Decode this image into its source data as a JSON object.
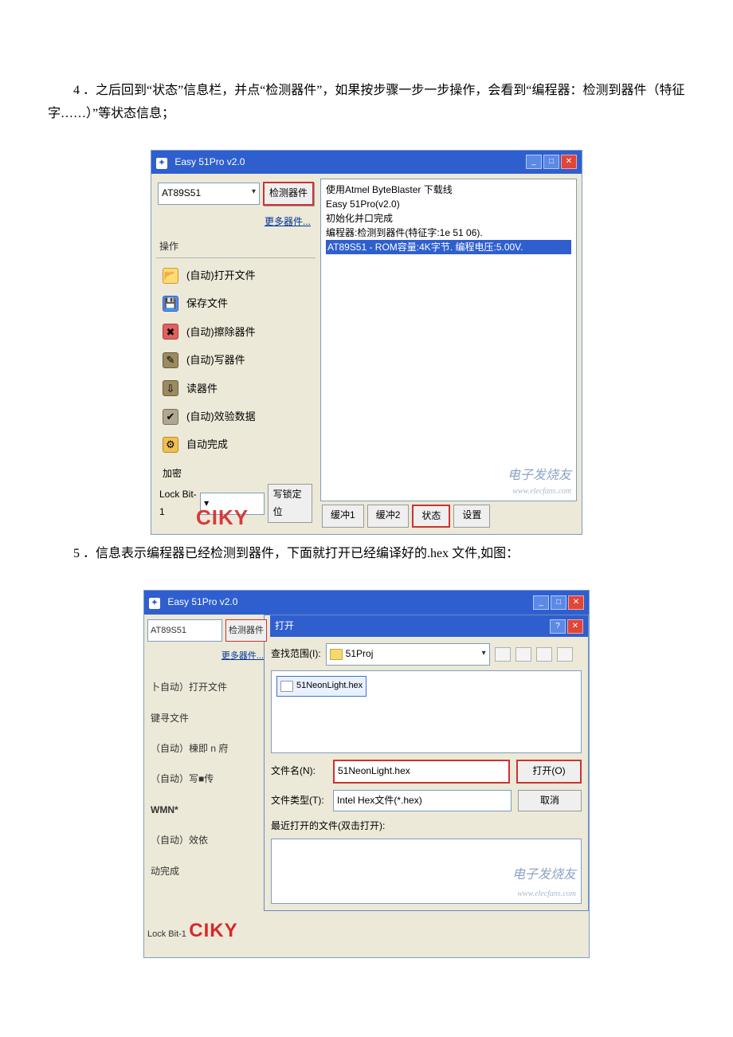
{
  "para1": "4 ．之后回到“状态”信息栏，并点“检测器件”，如果按步骤一步一步操作，会看到“编程器：检测到器件（特征字……）”等状态信息；",
  "para2": "5 ．信息表示编程器已经检测到器件，下面就打开已经编译好的.hex 文件,如图：",
  "win1": {
    "title": "Easy 51Pro v2.0",
    "chip": "AT89S51",
    "detect": "检测器件",
    "moredev": "更多器件...",
    "ops_label": "操作",
    "ops": {
      "open": "(自动)打开文件",
      "save": "保存文件",
      "erase": "(自动)擦除器件",
      "write": "(自动)写器件",
      "read": "读器件",
      "verify": "(自动)效验数据",
      "auto": "自动完成"
    },
    "jiami": "加密",
    "lock_label": "Lock Bit-1",
    "lock_btn": "写锁定位",
    "ciky": "CIKY",
    "status": {
      "l1": "使用Atmel ByteBlaster 下载线",
      "l2": "Easy 51Pro(v2.0)",
      "l3": "初始化并口完成",
      "l4": "编程器:检测到器件(特征字:1e 51 06).",
      "l5": "AT89S51 - ROM容量:4K字节. 编程电压:5.00V."
    },
    "tabs": {
      "buf1": "缓冲1",
      "buf2": "缓冲2",
      "status": "状态",
      "settings": "设置"
    },
    "watermark": "电子发烧友",
    "watermark_url": "www.elecfans.com"
  },
  "win2": {
    "title": "Easy 51Pro v2.0",
    "chip": "AT89S51",
    "detect": "检测器件",
    "moredev": "更多器件...",
    "left": {
      "open": "卜自动）打开文件",
      "save": "键寻文件",
      "erase": "（自动）棟即 n 府",
      "write": "（自动）写■传",
      "wmn": "WMN*",
      "verify": "（自动）效依",
      "auto": "动完成",
      "lock": "Lock Bit-1",
      "ciky": "CIKY"
    },
    "dlg": {
      "title": "打开",
      "lookin_label": "查找范围(I):",
      "folder": "51Proj",
      "file_item": "51NeonLight.hex",
      "filename_label": "文件名(N):",
      "filename_value": "51NeonLight.hex",
      "filetype_label": "文件类型(T):",
      "filetype_value": "Intel Hex文件(*.hex)",
      "open_btn": "打开(O)",
      "cancel_btn": "取消",
      "recent_label": "最近打开的文件(双击打开):",
      "watermark": "电子发烧友",
      "watermark_url": "www.elecfans.com"
    }
  }
}
